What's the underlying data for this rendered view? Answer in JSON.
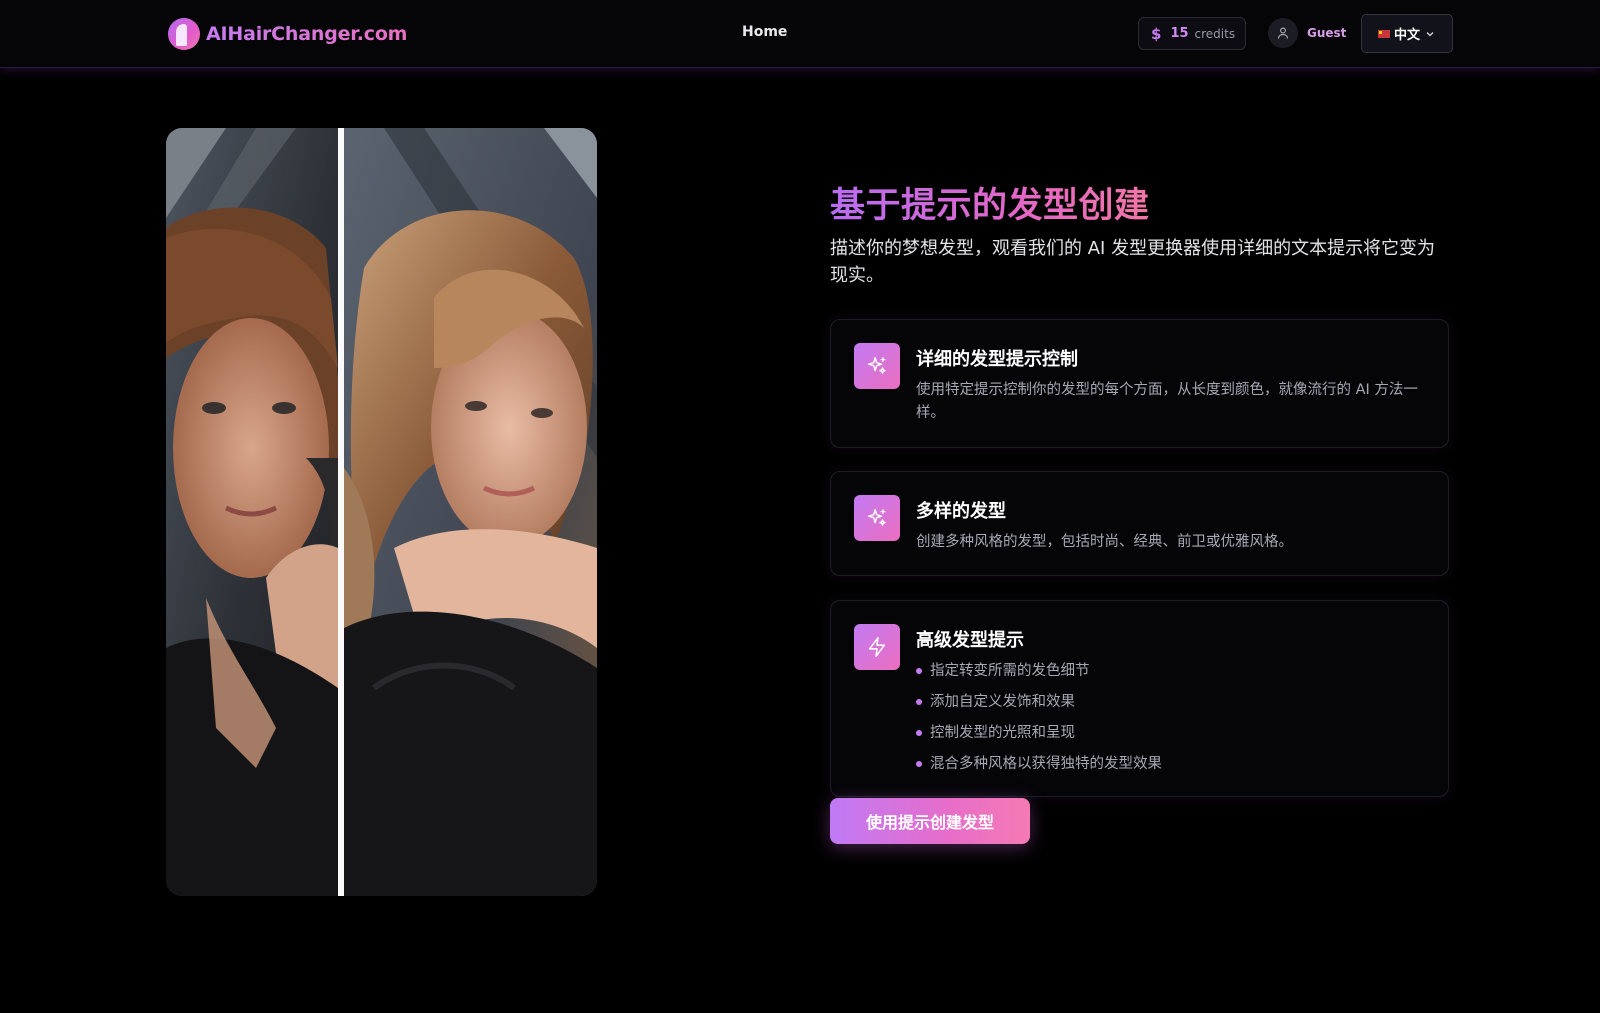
{
  "header": {
    "logo_text": "AIHairChanger.com",
    "nav_home": "Home",
    "credits": {
      "amount": "15",
      "label": "credits",
      "icon": "dollar-icon"
    },
    "user": {
      "name": "Guest",
      "icon": "user-icon"
    },
    "language": {
      "label": "中文",
      "flag_icon": "china-flag-icon"
    }
  },
  "hero": {
    "image_icon": "before-after-photo"
  },
  "content": {
    "title": "基于提示的发型创建",
    "subtitle": "描述你的梦想发型，观看我们的 AI 发型更换器使用详细的文本提示将它变为现实。",
    "cards": [
      {
        "icon": "sparkles-icon",
        "title": "详细的发型提示控制",
        "description": "使用特定提示控制你的发型的每个方面，从长度到颜色，就像流行的 AI 方法一样。"
      },
      {
        "icon": "sparkles-icon",
        "title": "多样的发型",
        "description": "创建多种风格的发型，包括时尚、经典、前卫或优雅风格。"
      },
      {
        "icon": "lightning-icon",
        "title": "高级发型提示",
        "bullets": [
          "指定转变所需的发色细节",
          "添加自定义发饰和效果",
          "控制发型的光照和呈现",
          "混合多种风格以获得独特的发型效果"
        ]
      }
    ],
    "cta_label": "使用提示创建发型"
  },
  "colors": {
    "accent_purple": "#c77bf2",
    "accent_pink": "#ec6ec0",
    "background": "#000000"
  }
}
